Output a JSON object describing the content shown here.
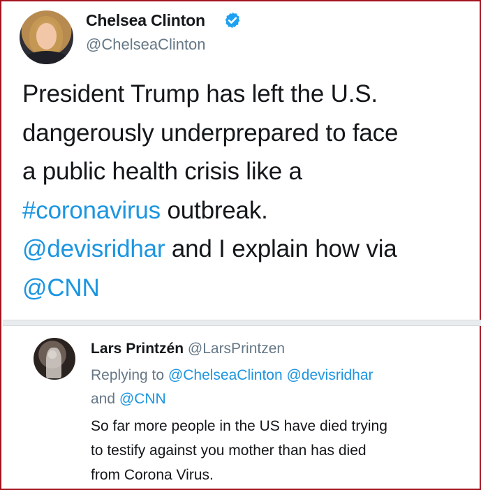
{
  "tweet": {
    "author_name": "Chelsea Clinton",
    "author_handle": "@ChelseaClinton",
    "verified_icon": "verified-badge-icon",
    "lines": [
      {
        "parts": [
          {
            "text": "President Trump has left the U.S.",
            "link": false
          }
        ]
      },
      {
        "parts": [
          {
            "text": "dangerously underprepared to face",
            "link": false
          }
        ]
      },
      {
        "parts": [
          {
            "text": "a public health crisis like a",
            "link": false
          }
        ]
      },
      {
        "parts": [
          {
            "text": "#coronavirus",
            "link": true
          },
          {
            "text": " outbreak.",
            "link": false
          }
        ]
      },
      {
        "parts": [
          {
            "text": "@devisridhar",
            "link": true
          },
          {
            "text": " and I explain how via",
            "link": false
          }
        ]
      },
      {
        "parts": [
          {
            "text": "@CNN",
            "link": true
          }
        ]
      }
    ]
  },
  "reply": {
    "author_name": "Lars Printzén",
    "author_handle": "@LarsPrintzen",
    "context_line1_prefix": "Replying to ",
    "context_mention1": "@ChelseaClinton",
    "context_mention2": "@devisridhar",
    "context_line2_prefix": "and ",
    "context_mention3": "@CNN",
    "text_lines": [
      "So far more people in the US have died trying",
      "to testify against you mother than has died",
      "from Corona Virus."
    ]
  },
  "colors": {
    "link": "#1b95e0",
    "muted": "#657786",
    "text": "#14171a",
    "verified": "#1da1f2",
    "frame": "#a3141f"
  }
}
